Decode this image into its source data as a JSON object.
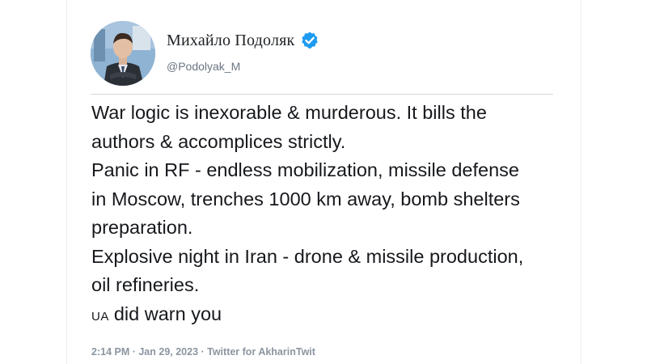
{
  "author": {
    "display_name": "Михайло Подоляк",
    "handle": "@Podolyak_M",
    "verified_icon": "verified-badge-icon"
  },
  "tweet": {
    "lines": [
      "War logic is inexorable & murderous. It bills the",
      "authors & accomplices strictly.",
      "Panic in RF - endless mobilization, missile defense",
      "in Moscow, trenches 1000 km away, bomb shelters",
      "preparation.",
      "Explosive night in Iran - drone & missile production,",
      "oil refineries."
    ],
    "last_line_flag": "UA",
    "last_line_text": "did warn you"
  },
  "meta": {
    "timestamp": "2:14 PM · Jan 29, 2023 · Twitter for AkharinTwit"
  },
  "colors": {
    "verified": "#1d9bf0",
    "text": "#16181c",
    "meta": "#8b95a0"
  }
}
